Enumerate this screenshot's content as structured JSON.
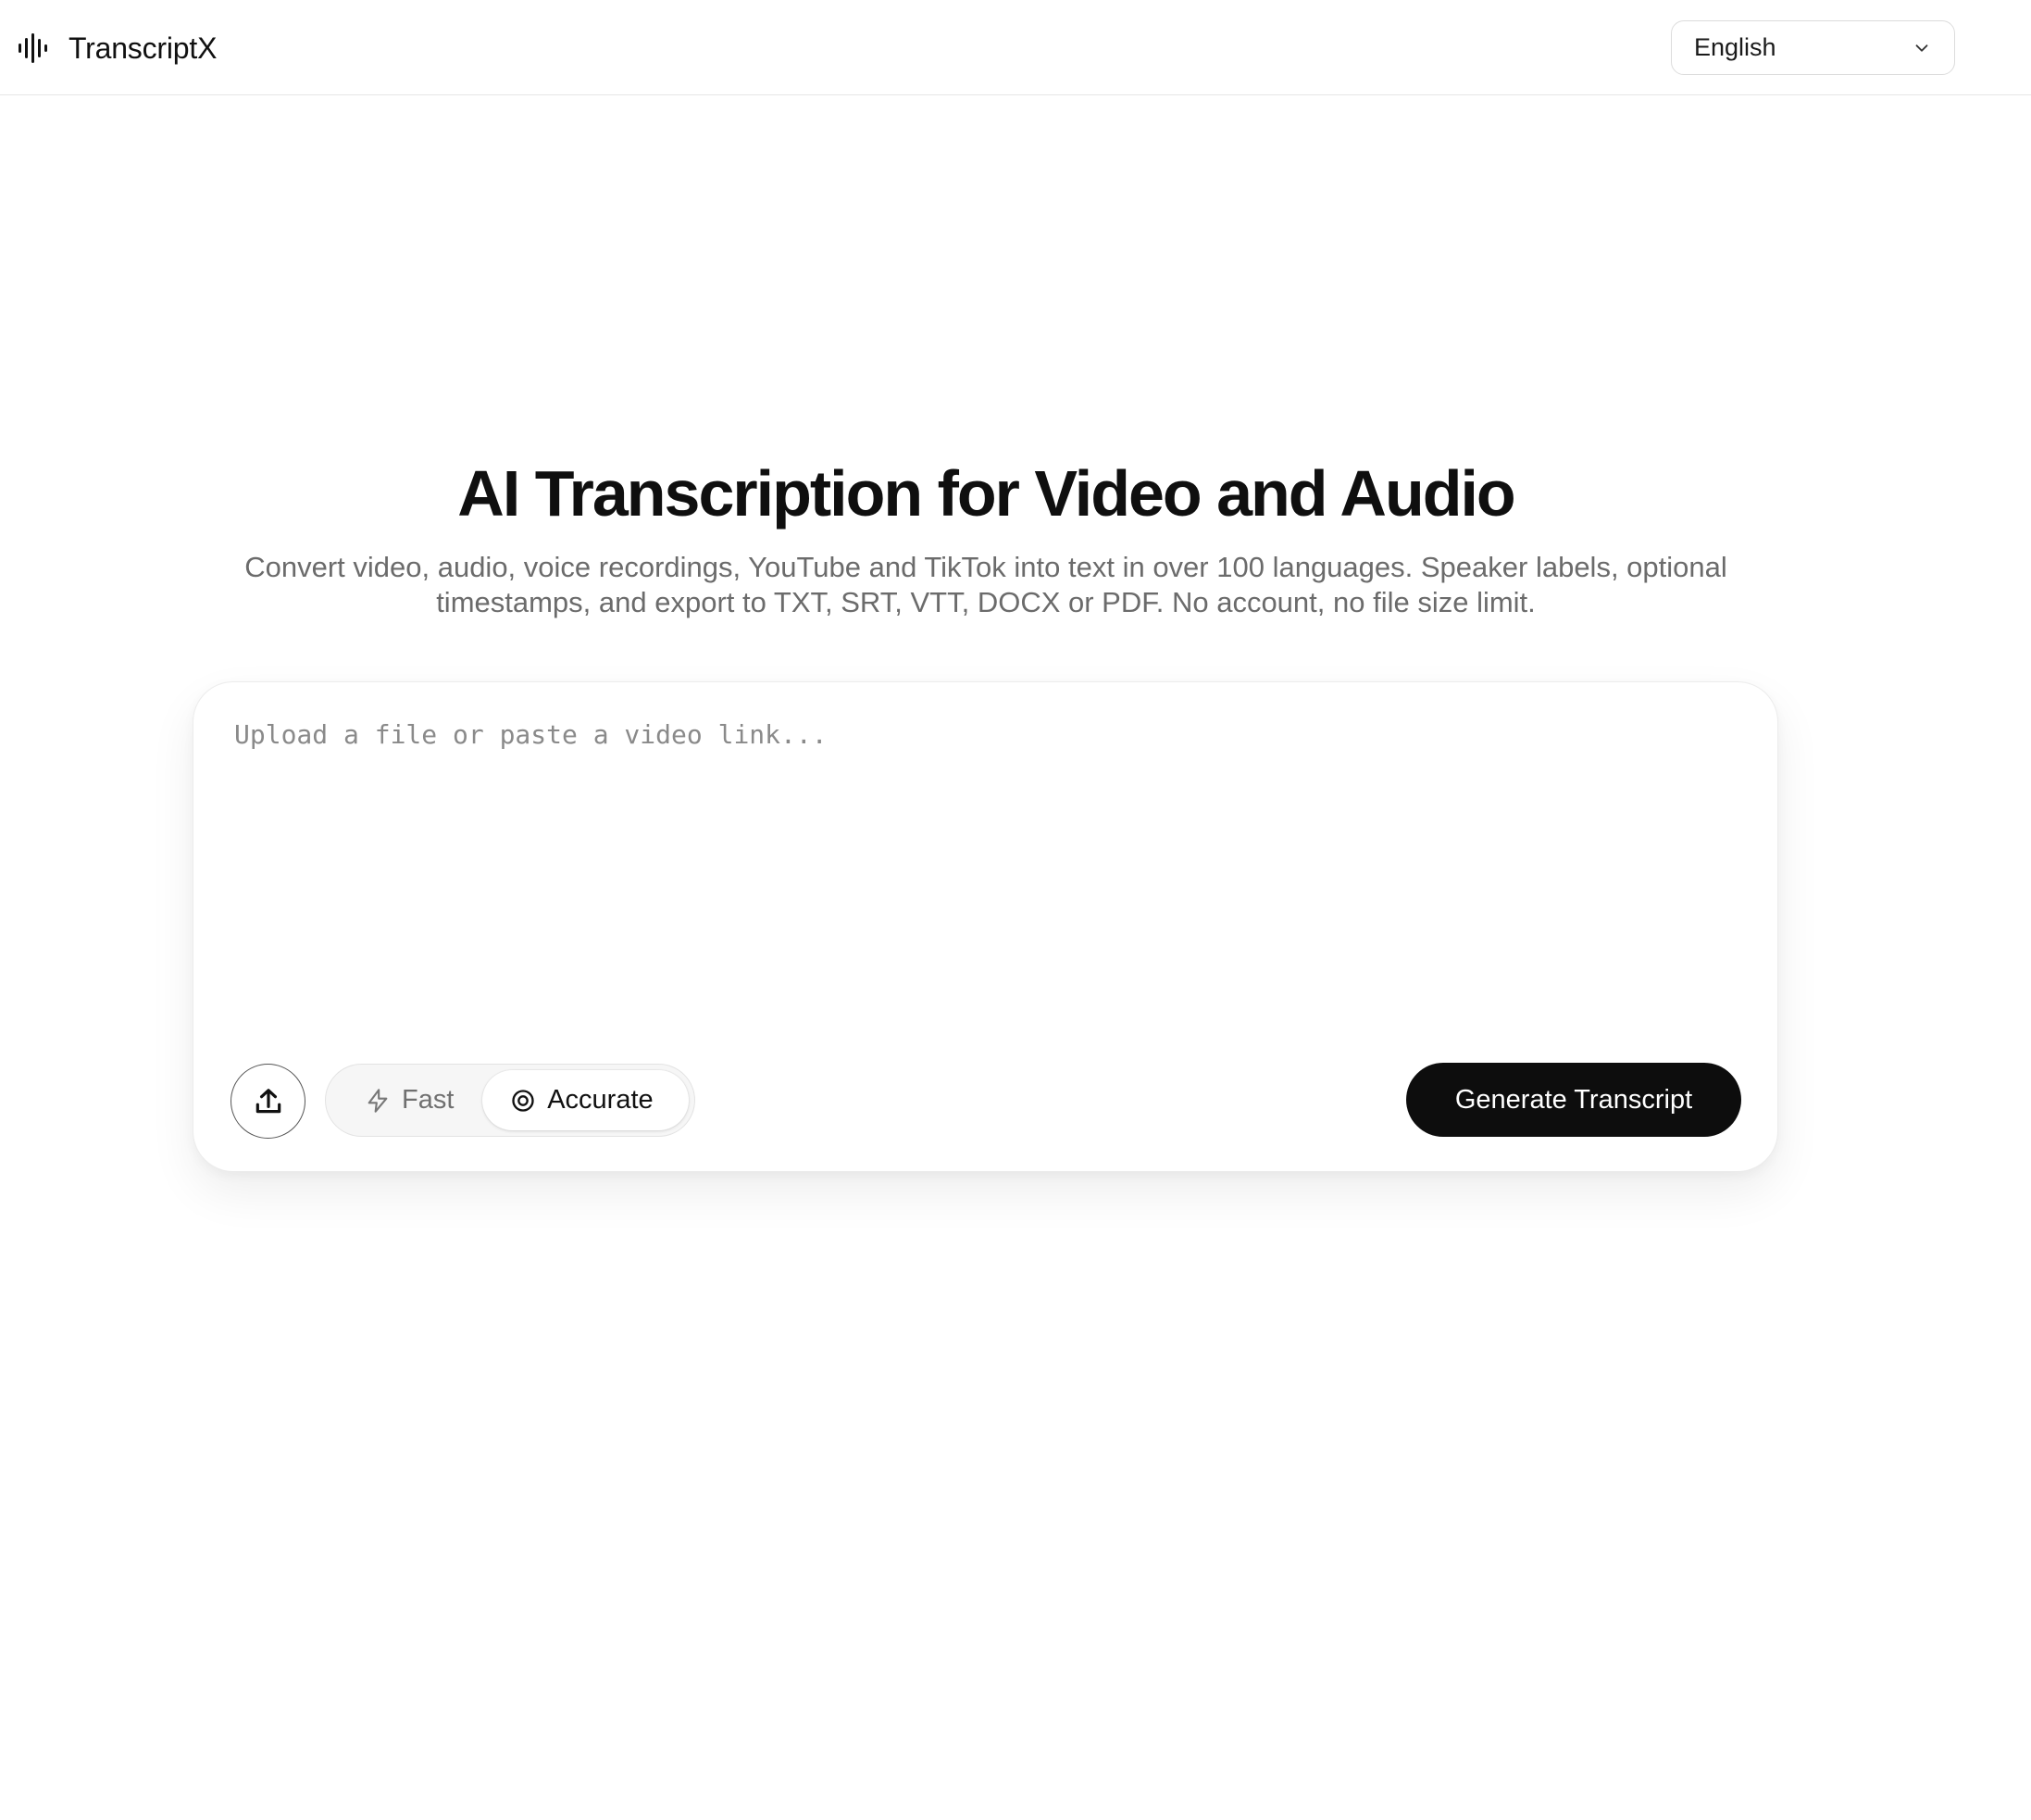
{
  "header": {
    "brand_name": "TranscriptX",
    "brand_icon": "waveform-icon",
    "language_select": {
      "selected": "English",
      "icon": "chevron-down-icon"
    }
  },
  "hero": {
    "title": "AI Transcription for Video and Audio",
    "subtitle": "Convert video, audio, voice recordings, YouTube and TikTok into text in over 100 languages. Speaker labels, optional timestamps, and export to TXT, SRT, VTT, DOCX or PDF. No account, no file size limit."
  },
  "composer": {
    "input_placeholder": "Upload a file or paste a video link...",
    "input_value": "",
    "upload_icon": "upload-icon",
    "modes": [
      {
        "label": "Fast",
        "icon": "lightning-icon",
        "selected": false
      },
      {
        "label": "Accurate",
        "icon": "target-icon",
        "selected": true
      }
    ],
    "generate_label": "Generate Transcript"
  },
  "colors": {
    "background": "#ffffff",
    "primary_button": "#0d0d0d",
    "text_primary": "#111111",
    "text_muted": "#6b6b6b",
    "border": "#e6e6e6"
  }
}
